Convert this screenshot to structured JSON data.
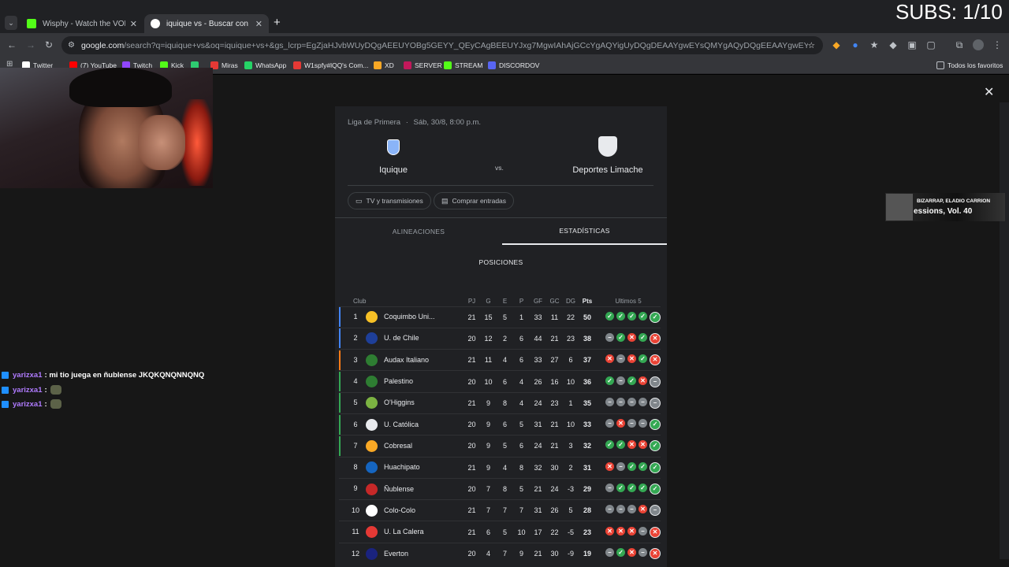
{
  "overlay": {
    "subs": "SUBS: 1/10"
  },
  "tabs": [
    {
      "title": "Wisphy - Watch the VOD on Ki",
      "color": "#53fc18"
    },
    {
      "title": "iquique vs - Buscar con Google",
      "color": "#4285f4"
    }
  ],
  "omnibox": {
    "host": "google.com",
    "path": "/search?q=iquique+vs&oq=iquique+vs+&gs_lcrp=EgZjaHJvbWUyDQgAEEUYOBg5GEYY_QEyCAgBEEUYJxg7MgwIAhAjGCcYgAQYigUyDQgDEAAYgwEYsQMYgAQyDQgEEAAYgwEYsQMYgAQyDQgFEAAYgwEYsQMYgAQyBggFEEUYPDIGCA..."
  },
  "bookmarks": [
    {
      "label": "Twitter",
      "color": "#ffffff"
    },
    {
      "label": "(7) YouTube",
      "color": "#ff0000"
    },
    {
      "label": "Twitch",
      "color": "#9146ff"
    },
    {
      "label": "Kick",
      "color": "#53fc18"
    },
    {
      "label": "",
      "color": "#2ecc71"
    },
    {
      "label": "Miras",
      "color": "#e53935"
    },
    {
      "label": "WhatsApp",
      "color": "#25d366"
    },
    {
      "label": "W1spfy#lQQ's Com...",
      "color": "#e53935"
    },
    {
      "label": "XD",
      "color": "#f9a825"
    },
    {
      "label": "SERVER",
      "color": "#c2185b"
    },
    {
      "label": "STREAM",
      "color": "#53fc18"
    },
    {
      "label": "DISCORDOV",
      "color": "#5865f2"
    }
  ],
  "bookmarks_right": "Todos los favoritos",
  "match": {
    "league": "Liga de Primera",
    "date": "Sáb, 30/8, 8:00 p.m.",
    "home": "Iquique",
    "away": "Deportes Limache",
    "vs": "vs.",
    "chip_tv": "TV y transmisiones",
    "chip_tickets": "Comprar entradas",
    "tab_lineups": "ALINEACIONES",
    "tab_stats": "ESTADÍSTICAS",
    "section": "POSICIONES"
  },
  "table_headers": {
    "club": "Club",
    "pj": "PJ",
    "g": "G",
    "e": "E",
    "p": "P",
    "gf": "GF",
    "gc": "GC",
    "dg": "DG",
    "pts": "Pts",
    "last5": "Ultimos 5"
  },
  "standings": [
    {
      "pos": "1",
      "club": "Coquimbo Uni...",
      "pj": "21",
      "g": "15",
      "e": "5",
      "p": "1",
      "gf": "33",
      "gc": "11",
      "dg": "22",
      "pts": "50",
      "zone": "#4285f4",
      "crest": "#f6c026",
      "form": [
        "W",
        "W",
        "W",
        "W",
        "W"
      ]
    },
    {
      "pos": "2",
      "club": "U. de Chile",
      "pj": "20",
      "g": "12",
      "e": "2",
      "p": "6",
      "gf": "44",
      "gc": "21",
      "dg": "23",
      "pts": "38",
      "zone": "#4285f4",
      "crest": "#1e3f99",
      "form": [
        "D",
        "W",
        "L",
        "W",
        "L"
      ]
    },
    {
      "pos": "3",
      "club": "Audax Italiano",
      "pj": "21",
      "g": "11",
      "e": "4",
      "p": "6",
      "gf": "33",
      "gc": "27",
      "dg": "6",
      "pts": "37",
      "zone": "#fa7b17",
      "crest": "#2e7d32",
      "form": [
        "L",
        "D",
        "L",
        "W",
        "L"
      ]
    },
    {
      "pos": "4",
      "club": "Palestino",
      "pj": "20",
      "g": "10",
      "e": "6",
      "p": "4",
      "gf": "26",
      "gc": "16",
      "dg": "10",
      "pts": "36",
      "zone": "#34a853",
      "crest": "#2e7d32",
      "form": [
        "W",
        "D",
        "W",
        "L",
        "D"
      ]
    },
    {
      "pos": "5",
      "club": "O'Higgins",
      "pj": "21",
      "g": "9",
      "e": "8",
      "p": "4",
      "gf": "24",
      "gc": "23",
      "dg": "1",
      "pts": "35",
      "zone": "#34a853",
      "crest": "#7cb342",
      "form": [
        "D",
        "D",
        "D",
        "D",
        "D"
      ]
    },
    {
      "pos": "6",
      "club": "U. Católica",
      "pj": "20",
      "g": "9",
      "e": "6",
      "p": "5",
      "gf": "31",
      "gc": "21",
      "dg": "10",
      "pts": "33",
      "zone": "#34a853",
      "crest": "#e8eaed",
      "form": [
        "D",
        "L",
        "D",
        "D",
        "W"
      ]
    },
    {
      "pos": "7",
      "club": "Cobresal",
      "pj": "20",
      "g": "9",
      "e": "5",
      "p": "6",
      "gf": "24",
      "gc": "21",
      "dg": "3",
      "pts": "32",
      "zone": "#34a853",
      "crest": "#f9a825",
      "form": [
        "W",
        "W",
        "L",
        "L",
        "W"
      ]
    },
    {
      "pos": "8",
      "club": "Huachipato",
      "pj": "21",
      "g": "9",
      "e": "4",
      "p": "8",
      "gf": "32",
      "gc": "30",
      "dg": "2",
      "pts": "31",
      "zone": "",
      "crest": "#1565c0",
      "form": [
        "L",
        "D",
        "W",
        "W",
        "W"
      ]
    },
    {
      "pos": "9",
      "club": "Ñublense",
      "pj": "20",
      "g": "7",
      "e": "8",
      "p": "5",
      "gf": "21",
      "gc": "24",
      "dg": "-3",
      "pts": "29",
      "zone": "",
      "crest": "#c62828",
      "form": [
        "D",
        "W",
        "W",
        "W",
        "W"
      ]
    },
    {
      "pos": "10",
      "club": "Colo-Colo",
      "pj": "21",
      "g": "7",
      "e": "7",
      "p": "7",
      "gf": "31",
      "gc": "26",
      "dg": "5",
      "pts": "28",
      "zone": "",
      "crest": "#ffffff",
      "form": [
        "D",
        "D",
        "D",
        "L",
        "D"
      ]
    },
    {
      "pos": "11",
      "club": "U. La Calera",
      "pj": "21",
      "g": "6",
      "e": "5",
      "p": "10",
      "gf": "17",
      "gc": "22",
      "dg": "-5",
      "pts": "23",
      "zone": "",
      "crest": "#e53935",
      "form": [
        "L",
        "L",
        "L",
        "D",
        "L"
      ]
    },
    {
      "pos": "12",
      "club": "Everton",
      "pj": "20",
      "g": "4",
      "e": "7",
      "p": "9",
      "gf": "21",
      "gc": "30",
      "dg": "-9",
      "pts": "19",
      "zone": "",
      "crest": "#1a237e",
      "form": [
        "D",
        "W",
        "L",
        "D",
        "L"
      ]
    }
  ],
  "chat": [
    {
      "user": "yarizxa1",
      "msg": ": mi tio juega en ñublense JKQKQNQNNQNQ",
      "emote": false
    },
    {
      "user": "yarizxa1",
      "msg": ":",
      "emote": true
    },
    {
      "user": "yarizxa1",
      "msg": ":",
      "emote": true
    }
  ],
  "music": {
    "artist": "BIZARRAP, ELADIO CARRION",
    "title": "essions, Vol. 40"
  }
}
